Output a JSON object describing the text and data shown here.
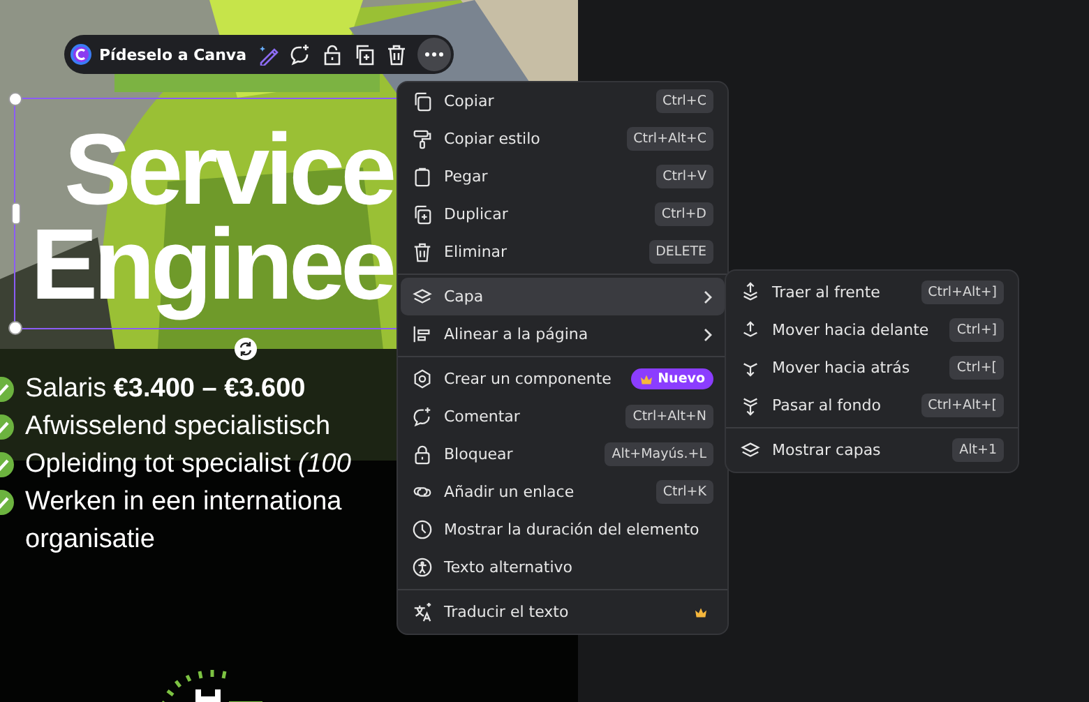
{
  "toolbar": {
    "ask_label": "Pídeselo a Canva"
  },
  "design": {
    "title_lines": [
      "Service",
      "Enginee"
    ],
    "bullets": [
      {
        "text": "Salaris **€3.400 – €3.600**",
        "checked": true
      },
      {
        "text": "Afwisselend specialistisch",
        "checked": true
      },
      {
        "text": "Opleiding tot specialist *(100*",
        "checked": true
      },
      {
        "text": "Werken in een internationa",
        "checked": true
      },
      {
        "text": "organisatie",
        "checked": false
      }
    ]
  },
  "context_menu": {
    "sections": [
      [
        {
          "label": "Copiar",
          "shortcut": "Ctrl+C",
          "selected": false
        },
        {
          "label": "Copiar estilo",
          "shortcut": "Ctrl+Alt+C",
          "selected": false
        },
        {
          "label": "Pegar",
          "shortcut": "Ctrl+V",
          "selected": false
        },
        {
          "label": "Duplicar",
          "shortcut": "Ctrl+D",
          "selected": false
        },
        {
          "label": "Eliminar",
          "shortcut": "DELETE",
          "selected": false
        }
      ],
      [
        {
          "label": "Capa",
          "has_submenu": true,
          "selected": true
        },
        {
          "label": "Alinear a la página",
          "has_submenu": true,
          "selected": false
        }
      ],
      [
        {
          "label": "Crear un componente",
          "badge": "Nuevo",
          "selected": false
        },
        {
          "label": "Comentar",
          "shortcut": "Ctrl+Alt+N",
          "selected": false
        },
        {
          "label": "Bloquear",
          "shortcut": "Alt+Mayús.+L",
          "selected": false
        },
        {
          "label": "Añadir un enlace",
          "shortcut": "Ctrl+K",
          "selected": false
        },
        {
          "label": "Mostrar la duración del elemento",
          "selected": false
        },
        {
          "label": "Texto alternativo",
          "selected": false
        }
      ],
      [
        {
          "label": "Traducir el texto",
          "premium": true,
          "selected": false
        }
      ]
    ]
  },
  "submenu": {
    "sections": [
      [
        {
          "label": "Traer al frente",
          "shortcut": "Ctrl+Alt+]"
        },
        {
          "label": "Mover hacia delante",
          "shortcut": "Ctrl+]"
        },
        {
          "label": "Mover hacia atrás",
          "shortcut": "Ctrl+["
        },
        {
          "label": "Pasar al fondo",
          "shortcut": "Ctrl+Alt+["
        }
      ],
      [
        {
          "label": "Mostrar capas",
          "shortcut": "Alt+1"
        }
      ]
    ]
  }
}
